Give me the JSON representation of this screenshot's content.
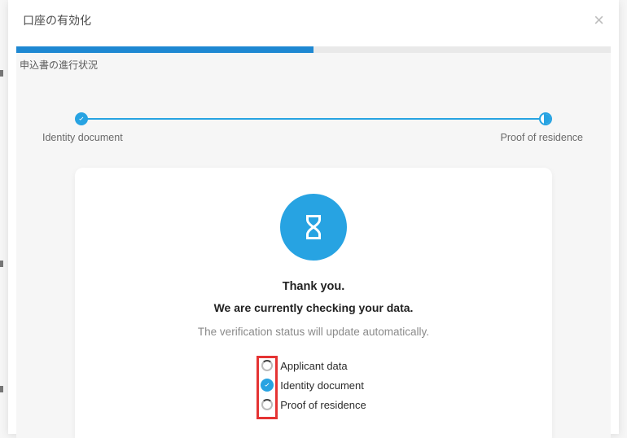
{
  "modal": {
    "title": "口座の有効化",
    "subtitle": "申込書の進行状況",
    "progress_percent": 50
  },
  "stepper": {
    "left_label": "Identity document",
    "right_label": "Proof of residence"
  },
  "card": {
    "thank_you": "Thank you.",
    "checking": "We are currently checking your data.",
    "auto_update": "The verification status will update automatically.",
    "items": [
      {
        "label": "Applicant data",
        "status": "pending"
      },
      {
        "label": "Identity document",
        "status": "done"
      },
      {
        "label": "Proof of residence",
        "status": "pending"
      }
    ]
  }
}
